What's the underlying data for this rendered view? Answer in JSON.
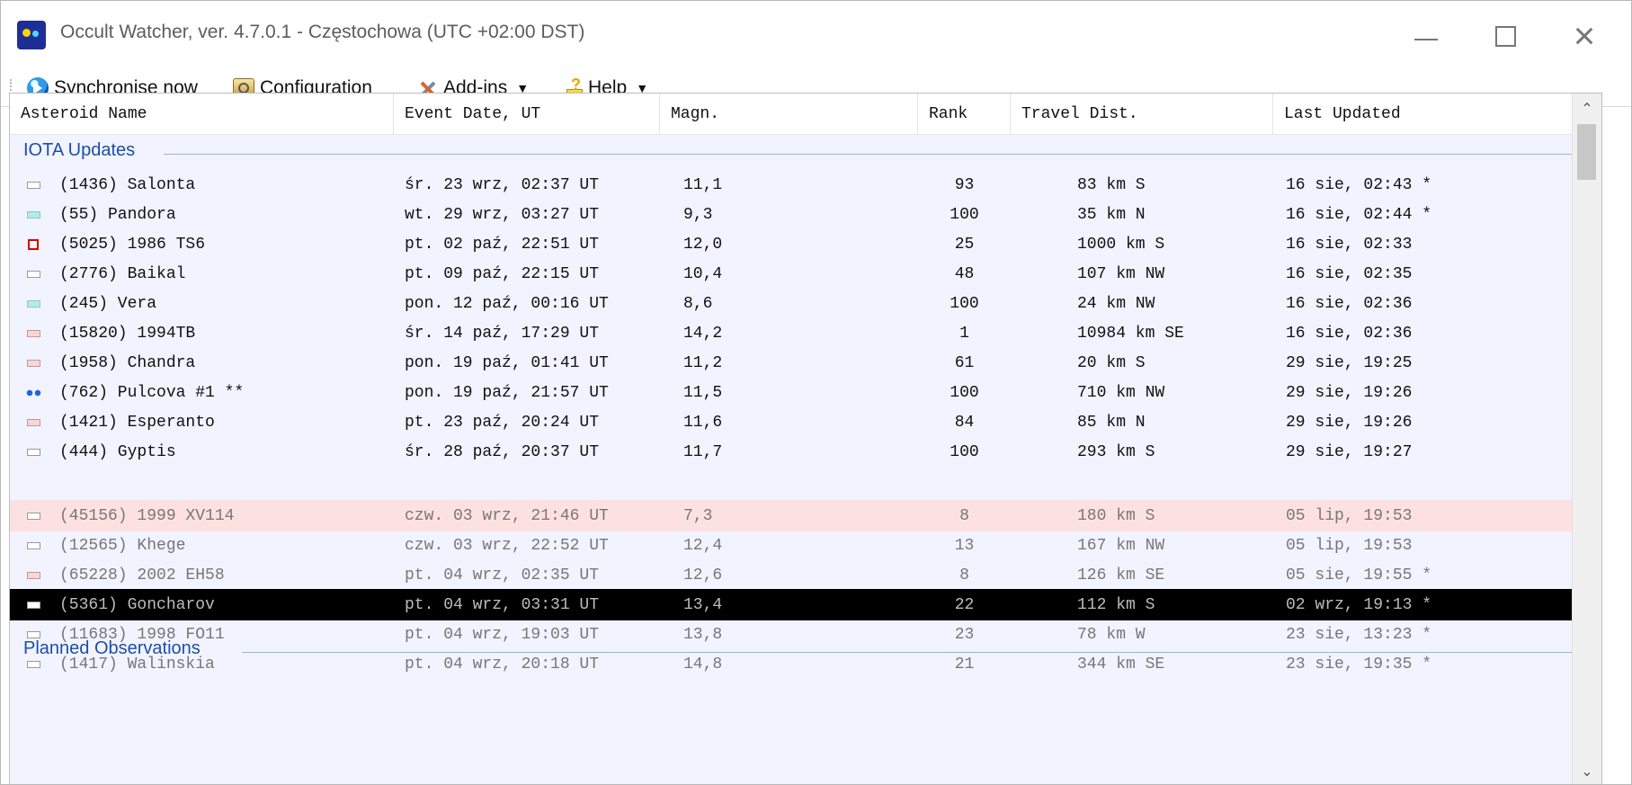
{
  "window": {
    "title": "Occult Watcher, ver. 4.7.0.1 - Częstochowa (UTC +02:00 DST)"
  },
  "toolbar": {
    "sync_label": "Synchronise now",
    "config_label": "Configuration",
    "addins_label": "Add-ins",
    "help_label": "Help"
  },
  "columns": [
    "Asteroid Name",
    "Event Date, UT",
    "Magn.",
    "Rank",
    "Travel Dist.",
    "Last Updated"
  ],
  "groups": {
    "iota": "IOTA Updates",
    "planned": "Planned Observations"
  },
  "rows": [
    {
      "name": "(1436) Salonta",
      "date": "śr. 23 wrz, 02:37 UT",
      "mag": "11,1",
      "rank": "93",
      "dist": "83 km S",
      "updated": "16 sie, 02:43 *",
      "state": "white"
    },
    {
      "name": "  (55) Pandora",
      "date": "wt. 29 wrz, 03:27 UT",
      "mag": " 9,3",
      "rank": "100",
      "dist": "35 km N",
      "updated": "16 sie, 02:44 *",
      "state": "cyan"
    },
    {
      "name": "(5025) 1986 TS6",
      "date": "pt. 02 paź, 22:51 UT",
      "mag": "12,0",
      "rank": "25",
      "dist": "1000 km S",
      "updated": "16 sie, 02:33",
      "state": "red"
    },
    {
      "name": "(2776) Baikal",
      "date": "pt. 09 paź, 22:15 UT",
      "mag": "10,4",
      "rank": "48",
      "dist": "107 km NW",
      "updated": "16 sie, 02:35",
      "state": "white"
    },
    {
      "name": " (245) Vera",
      "date": "pon. 12 paź, 00:16 UT",
      "mag": " 8,6",
      "rank": "100",
      "dist": "24 km NW",
      "updated": "16 sie, 02:36",
      "state": "cyan"
    },
    {
      "name": "(15820) 1994TB",
      "date": "śr. 14 paź, 17:29 UT",
      "mag": "14,2",
      "rank": "1",
      "dist": "10984 km SE",
      "updated": "16 sie, 02:36",
      "state": "pink"
    },
    {
      "name": "(1958) Chandra",
      "date": "pon. 19 paź, 01:41 UT",
      "mag": "11,2",
      "rank": "61",
      "dist": "20 km S",
      "updated": "29 sie, 19:25",
      "state": "pink"
    },
    {
      "name": " (762) Pulcova #1 **",
      "date": "pon. 19 paź, 21:57 UT",
      "mag": "11,5",
      "rank": "100",
      "dist": "710 km NW",
      "updated": "29 sie, 19:26",
      "state": "dots"
    },
    {
      "name": "(1421) Esperanto",
      "date": "pt. 23 paź, 20:24 UT",
      "mag": "11,6",
      "rank": "84",
      "dist": "85 km N",
      "updated": "29 sie, 19:26",
      "state": "pink"
    },
    {
      "name": " (444) Gyptis",
      "date": "śr. 28 paź, 20:37 UT",
      "mag": "11,7",
      "rank": "100",
      "dist": "293 km S",
      "updated": "29 sie, 19:27",
      "state": "white"
    },
    {
      "name": "(45156) 1999 XV114",
      "date": "czw. 03 wrz, 21:46 UT",
      "mag": " 7,3",
      "rank": "8",
      "dist": "180 km S",
      "updated": "05 lip, 19:53",
      "state": "white"
    },
    {
      "name": "(12565) Khege",
      "date": "czw. 03 wrz, 22:52 UT",
      "mag": "12,4",
      "rank": "13",
      "dist": "167 km NW",
      "updated": "05 lip, 19:53",
      "state": "white"
    },
    {
      "name": "(65228) 2002 EH58",
      "date": "pt. 04 wrz, 02:35 UT",
      "mag": "12,6",
      "rank": "8",
      "dist": "126 km SE",
      "updated": "05 sie, 19:55 *",
      "state": "pink"
    },
    {
      "name": "(5361) Goncharov",
      "date": "pt. 04 wrz, 03:31 UT",
      "mag": "13,4",
      "rank": "22",
      "dist": "112 km S",
      "updated": "02 wrz, 19:13 *",
      "state": "white"
    },
    {
      "name": "(11683) 1998 FO11",
      "date": "pt. 04 wrz, 19:03 UT",
      "mag": "13,8",
      "rank": "23",
      "dist": "78 km W",
      "updated": "23 sie, 13:23 *",
      "state": "white"
    },
    {
      "name": "(1417) Walinskia",
      "date": "pt. 04 wrz, 20:18 UT",
      "mag": "14,8",
      "rank": "21",
      "dist": "344 km SE",
      "updated": "23 sie, 19:35 *",
      "state": "white"
    }
  ]
}
